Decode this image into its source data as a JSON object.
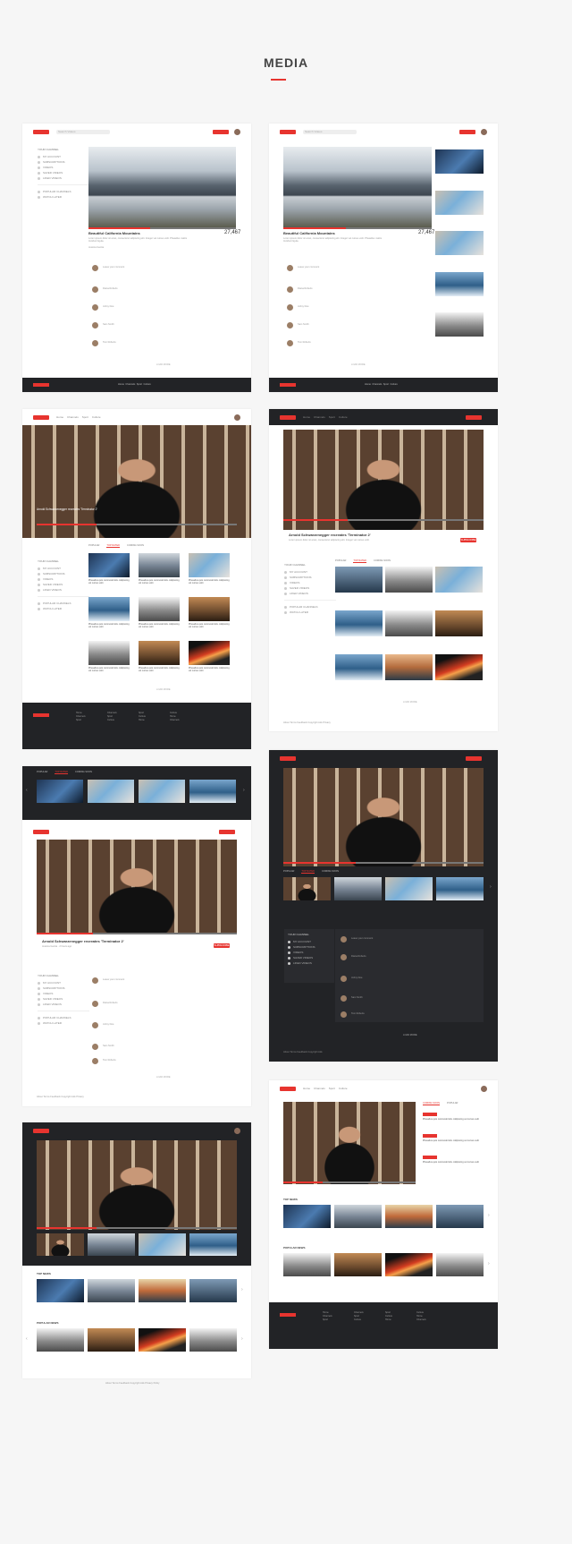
{
  "page": {
    "title": "MEDIA"
  },
  "colors": {
    "accent": "#e7342f",
    "dark": "#222326",
    "background": "#f6f6f6"
  },
  "header": {
    "search_placeholder": "Search Videos"
  },
  "nav": [
    "Home",
    "Channels",
    "Sport",
    "Culture"
  ],
  "sidebar": {
    "section": "YOUR CHANNEL",
    "items": [
      "MY ACCOUNT",
      "SUBSCRIPTIONS",
      "VIDEOS",
      "SAVED VIDEOS",
      "LIKED VIDEOS"
    ],
    "items2": [
      "POPULAR CHANNELS",
      "WATCH LATER"
    ]
  },
  "video_mountains": {
    "title": "Beautiful California Mountains",
    "views": "27,467",
    "description": "Lorem ipsum dolor sit amet, consectetur adipiscing elit. Integer vel cursus velit. Phasellus mattis tincidunt ligula.",
    "author": "Jessica Garcia"
  },
  "video_arnold": {
    "title": "Arnold Schwarzenegger recreates 'Terminator 2'",
    "description": "Lorem ipsum dolor sit amet, consectetur adipiscing elit. Integer vel cursus velit.",
    "meta": "Jessica Garcia · 2 hours ago",
    "subscribe": "SUBSCRIBE"
  },
  "comments_placeholder": "Leave your comment",
  "comment_authors": [
    "Diana Roberts",
    "Johny Doe",
    "Sam Smith",
    "Tom Roberts"
  ],
  "tabs": [
    "POPULAR",
    "TOP RATED",
    "COMING SOON"
  ],
  "load_more": "LOAD MORE",
  "top_news": "TOP NEWS",
  "popular_news": "POPULAR NEWS",
  "thumb_caption": "Phasellus quis commodo felis. Adipiscing vel cursus velit",
  "footer": {
    "links": [
      "Home",
      "Channels",
      "Sport",
      "Culture"
    ],
    "bottom_links": [
      "About",
      "Terms",
      "Feedback",
      "Copyright",
      "Ads",
      "Privacy",
      "Policy"
    ]
  }
}
